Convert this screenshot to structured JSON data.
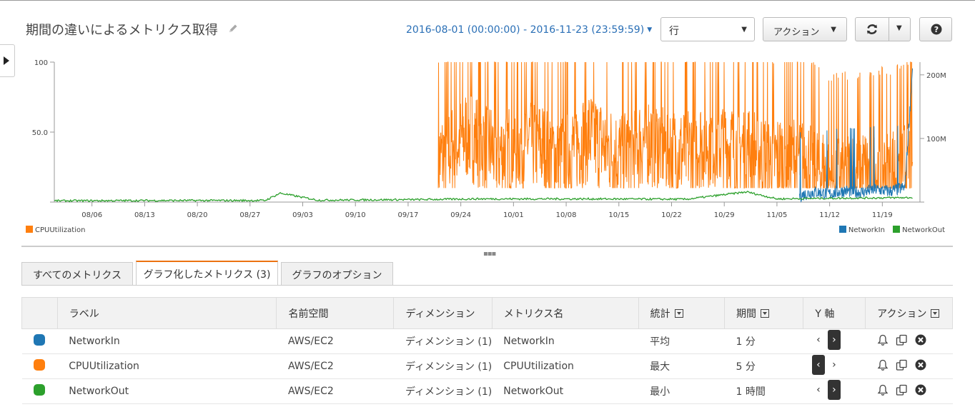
{
  "page": {
    "title": "期間の違いによるメトリクス取得",
    "date_range": "2016-08-01 (00:00:00) - 2016-11-23 (23:59:59)",
    "view_select": "行",
    "action_label": "アクション"
  },
  "chart_data": {
    "type": "line",
    "x_tick_labels": [
      "08/06",
      "08/13",
      "08/20",
      "08/27",
      "09/03",
      "09/10",
      "09/17",
      "09/24",
      "10/01",
      "10/08",
      "10/15",
      "10/22",
      "10/29",
      "11/05",
      "11/12",
      "11/19"
    ],
    "y_left_tick_labels": [
      "100",
      "50.0"
    ],
    "y_right_tick_labels": [
      "200M",
      "100M"
    ],
    "y_left_range": [
      0,
      100
    ],
    "y_right_range": [
      0,
      220000000
    ],
    "x_range": [
      "2016-08-01",
      "2016-11-23"
    ],
    "series": [
      {
        "name": "CPUUtilization",
        "axis": "left",
        "color": "#ff7f0e",
        "x": [
          "2016-09-21",
          "2016-09-25",
          "2016-09-29",
          "2016-10-03",
          "2016-10-07",
          "2016-10-11",
          "2016-10-15",
          "2016-10-19",
          "2016-10-23",
          "2016-10-27",
          "2016-10-31",
          "2016-11-01",
          "2016-11-04",
          "2016-11-08",
          "2016-11-12",
          "2016-11-16",
          "2016-11-20",
          "2016-11-23"
        ],
        "values": [
          30,
          50,
          35,
          45,
          32,
          48,
          33,
          46,
          34,
          45,
          38,
          40,
          30,
          32,
          18,
          20,
          22,
          30
        ]
      },
      {
        "name": "NetworkIn",
        "axis": "right",
        "color": "#1f77b4",
        "x": [
          "2016-11-08",
          "2016-11-10",
          "2016-11-12",
          "2016-11-14",
          "2016-11-16",
          "2016-11-18",
          "2016-11-20",
          "2016-11-22",
          "2016-11-23"
        ],
        "values": [
          12000000,
          18000000,
          15000000,
          20000000,
          17000000,
          22000000,
          19000000,
          25000000,
          210000000
        ]
      },
      {
        "name": "NetworkOut",
        "axis": "right",
        "color": "#2ca02c",
        "x": [
          "2016-08-01",
          "2016-08-15",
          "2016-08-29",
          "2016-08-31",
          "2016-09-05",
          "2016-09-19",
          "2016-09-26",
          "2016-10-10",
          "2016-10-24",
          "2016-11-01",
          "2016-11-05",
          "2016-11-12",
          "2016-11-23"
        ],
        "values": [
          2000000,
          2500000,
          2500000,
          14000000,
          3000000,
          4000000,
          5000000,
          5000000,
          4500000,
          16000000,
          5000000,
          6000000,
          7000000
        ]
      }
    ]
  },
  "legend": {
    "left": [
      "CPUUtilization"
    ],
    "right": [
      "NetworkIn",
      "NetworkOut"
    ]
  },
  "tabs": [
    "すべてのメトリクス",
    "グラフ化したメトリクス (3)",
    "グラフのオプション"
  ],
  "table": {
    "headers": [
      "ラベル",
      "名前空間",
      "ディメンション",
      "メトリクス名",
      "統計",
      "期間",
      "Y 軸",
      "アクション"
    ],
    "rows": [
      {
        "color": "#1f77b4",
        "label": "NetworkIn",
        "namespace": "AWS/EC2",
        "dimensions": "ディメンション (1)",
        "metric": "NetworkIn",
        "stat": "平均",
        "period": "1 分",
        "yaxis": "right"
      },
      {
        "color": "#ff7f0e",
        "label": "CPUUtilization",
        "namespace": "AWS/EC2",
        "dimensions": "ディメンション (1)",
        "metric": "CPUUtilization",
        "stat": "最大",
        "period": "5 分",
        "yaxis": "left"
      },
      {
        "color": "#2ca02c",
        "label": "NetworkOut",
        "namespace": "AWS/EC2",
        "dimensions": "ディメンション (1)",
        "metric": "NetworkOut",
        "stat": "最小",
        "period": "1 時間",
        "yaxis": "right"
      }
    ]
  },
  "icons": {
    "edit": "pencil-icon",
    "refresh": "refresh-icon",
    "help": "help-icon",
    "alarm": "bell-icon",
    "copy": "copy-icon",
    "remove": "remove-icon"
  }
}
